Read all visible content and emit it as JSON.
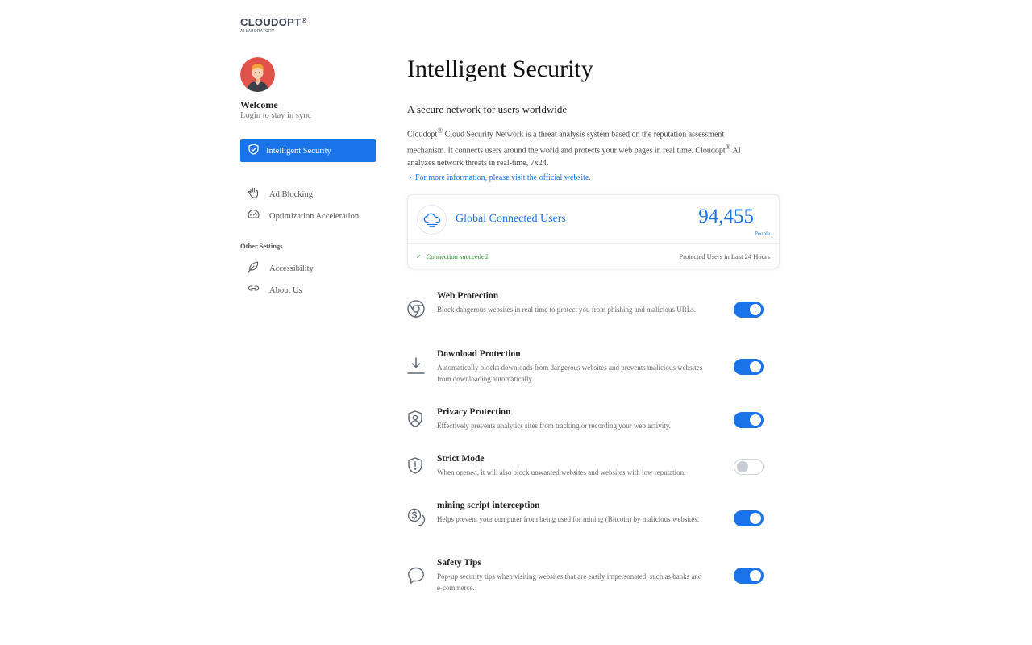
{
  "brand": {
    "name": "CLOUDOPT",
    "mark": "®",
    "tagline": "AI LABORATORY"
  },
  "user": {
    "welcome": "Welcome",
    "subtitle": "Login to stay in sync"
  },
  "sidebar": {
    "active": {
      "label": "Intelligent Security",
      "icon": "shield-check-icon"
    },
    "items": [
      {
        "label": "Ad Blocking",
        "icon": "hand-stop-icon"
      },
      {
        "label": "Optimization Acceleration",
        "icon": "speedometer-icon"
      }
    ],
    "section_title": "Other Settings",
    "other_items": [
      {
        "label": "Accessibility",
        "icon": "leaf-icon"
      },
      {
        "label": "About Us",
        "icon": "link-icon"
      }
    ]
  },
  "main": {
    "title": "Intelligent Security",
    "subtitle": "A secure network for users worldwide",
    "description": {
      "p1": "Cloudopt",
      "reg": "®",
      "p2": " Cloud Security Network is a threat analysis system based on the reputation assessment mechanism. It connects users around the world and protects your web pages in real time. Cloudopt",
      "p3": " AI analyzes network threats in real-time, 7x24."
    },
    "more_link": "For more information, please visit the official website.",
    "stats_card": {
      "icon": "cloud-icon",
      "title": "Global Connected Users",
      "count": "94,455",
      "unit": "People",
      "status": "Connection succeeded",
      "note": "Protected Users in Last 24 Hours",
      "status_color": "#2e8b2e"
    },
    "features": [
      {
        "title": "Web Protection",
        "desc": "Block dangerous websites in real time to protect you from phishing and malicious URLs.",
        "enabled": true,
        "icon": "chrome-icon"
      },
      {
        "title": "Download Protection",
        "desc": "Automatically blocks downloads from dangerous websites and prevents malicious websites from downloading automatically.",
        "enabled": true,
        "icon": "download-icon"
      },
      {
        "title": "Privacy Protection",
        "desc": "Effectively prevents analytics sites from tracking or recording your web activity.",
        "enabled": true,
        "icon": "user-shield-icon"
      },
      {
        "title": "Strict Mode",
        "desc": "When opened, it will also block unwanted websites and websites with low reputation.",
        "enabled": false,
        "icon": "shield-alert-icon"
      },
      {
        "title": "mining script interception",
        "desc": "Helps prevent your computer from being used for mining (Bitcoin) by malicious websites.",
        "enabled": true,
        "icon": "coins-icon"
      },
      {
        "title": "Safety Tips",
        "desc": "Pop-up security tips when visiting websites that are easily impersonated, such as banks and e-commerce.",
        "enabled": true,
        "icon": "speech-bubble-icon"
      }
    ]
  },
  "colors": {
    "accent": "#1a73e8",
    "success": "#2e8b2e",
    "avatar_bg": "#e0524a"
  }
}
